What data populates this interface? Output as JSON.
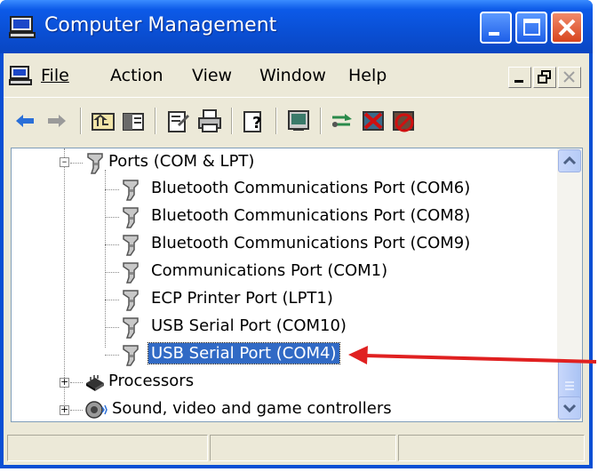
{
  "window": {
    "title": "Computer Management",
    "accent_color": "#0a4fd4",
    "close_color": "#d8451e"
  },
  "menu": {
    "items": [
      "File",
      "Action",
      "View",
      "Window",
      "Help"
    ]
  },
  "toolbar": {
    "icons": [
      "back-arrow-icon",
      "forward-arrow-icon",
      "up-folder-icon",
      "show-hide-tree-icon",
      "properties-icon",
      "print-icon",
      "help-icon",
      "computer-icon",
      "network-icon",
      "uninstall-icon",
      "disable-icon"
    ]
  },
  "tree": {
    "ports_group": "Ports (COM & LPT)",
    "ports": [
      "Bluetooth Communications Port (COM6)",
      "Bluetooth Communications Port (COM8)",
      "Bluetooth Communications Port (COM9)",
      "Communications Port (COM1)",
      "ECP Printer Port (LPT1)",
      "USB Serial Port (COM10)",
      "USB Serial Port (COM4)"
    ],
    "selected_index": 6,
    "processors": "Processors",
    "sound": "Sound, video and game controllers"
  },
  "annotation": {
    "arrow_color": "#e02020"
  }
}
